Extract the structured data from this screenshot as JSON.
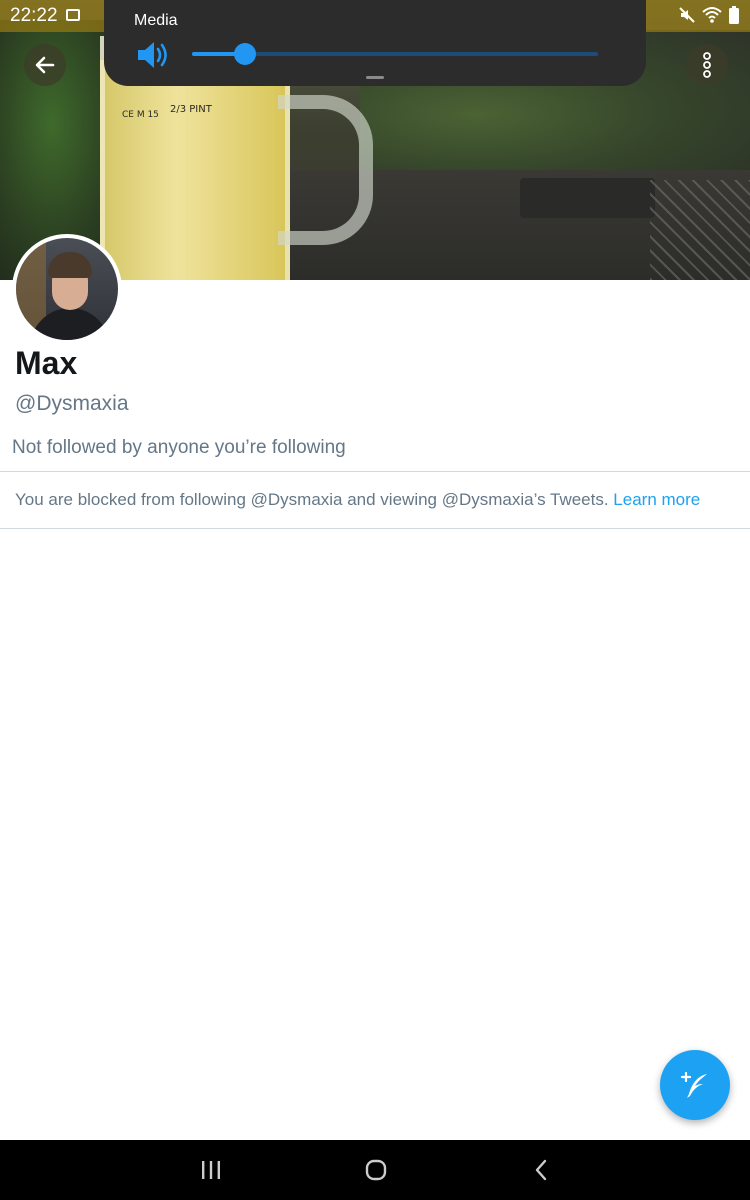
{
  "status_bar": {
    "time": "22:22"
  },
  "media_panel": {
    "label": "Media",
    "volume_fraction": 0.13
  },
  "profile": {
    "name": "Max",
    "handle": "@Dysmaxia",
    "followed_by": "Not followed by anyone you’re following"
  },
  "blocked": {
    "message": "You are blocked from following @Dysmaxia and viewing @Dysmaxia’s Tweets. ",
    "link": "Learn more"
  },
  "banner": {
    "glass_mark": "2/3 PINT",
    "glass_mark2": "CE M 15"
  },
  "colors": {
    "accent": "#1da1f2",
    "slider": "#2196f3",
    "text_secondary": "#657786"
  },
  "icons": {
    "back": "arrow-left-icon",
    "more": "more-vertical-icon",
    "volume": "speaker-icon",
    "compose": "compose-tweet-icon",
    "nav_recent": "recent-apps-icon",
    "nav_home": "home-icon",
    "nav_back": "back-icon"
  }
}
